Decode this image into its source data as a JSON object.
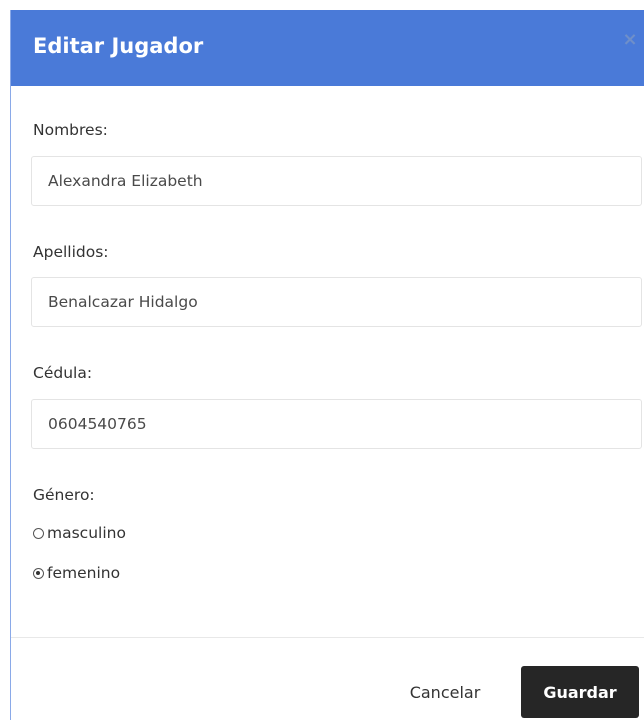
{
  "modal": {
    "title": "Editar Jugador",
    "close_label": "×"
  },
  "form": {
    "nombres": {
      "label": "Nombres:",
      "value": "Alexandra Elizabeth"
    },
    "apellidos": {
      "label": "Apellidos:",
      "value": "Benalcazar Hidalgo"
    },
    "cedula": {
      "label": "Cédula:",
      "value": "0604540765"
    },
    "genero": {
      "label": "Género:",
      "options": [
        {
          "label": "masculino",
          "selected": false
        },
        {
          "label": "femenino",
          "selected": true
        }
      ]
    }
  },
  "footer": {
    "cancel_label": "Cancelar",
    "save_label": "Guardar"
  },
  "colors": {
    "header": "#4a7ad8",
    "save_button": "#262626"
  }
}
